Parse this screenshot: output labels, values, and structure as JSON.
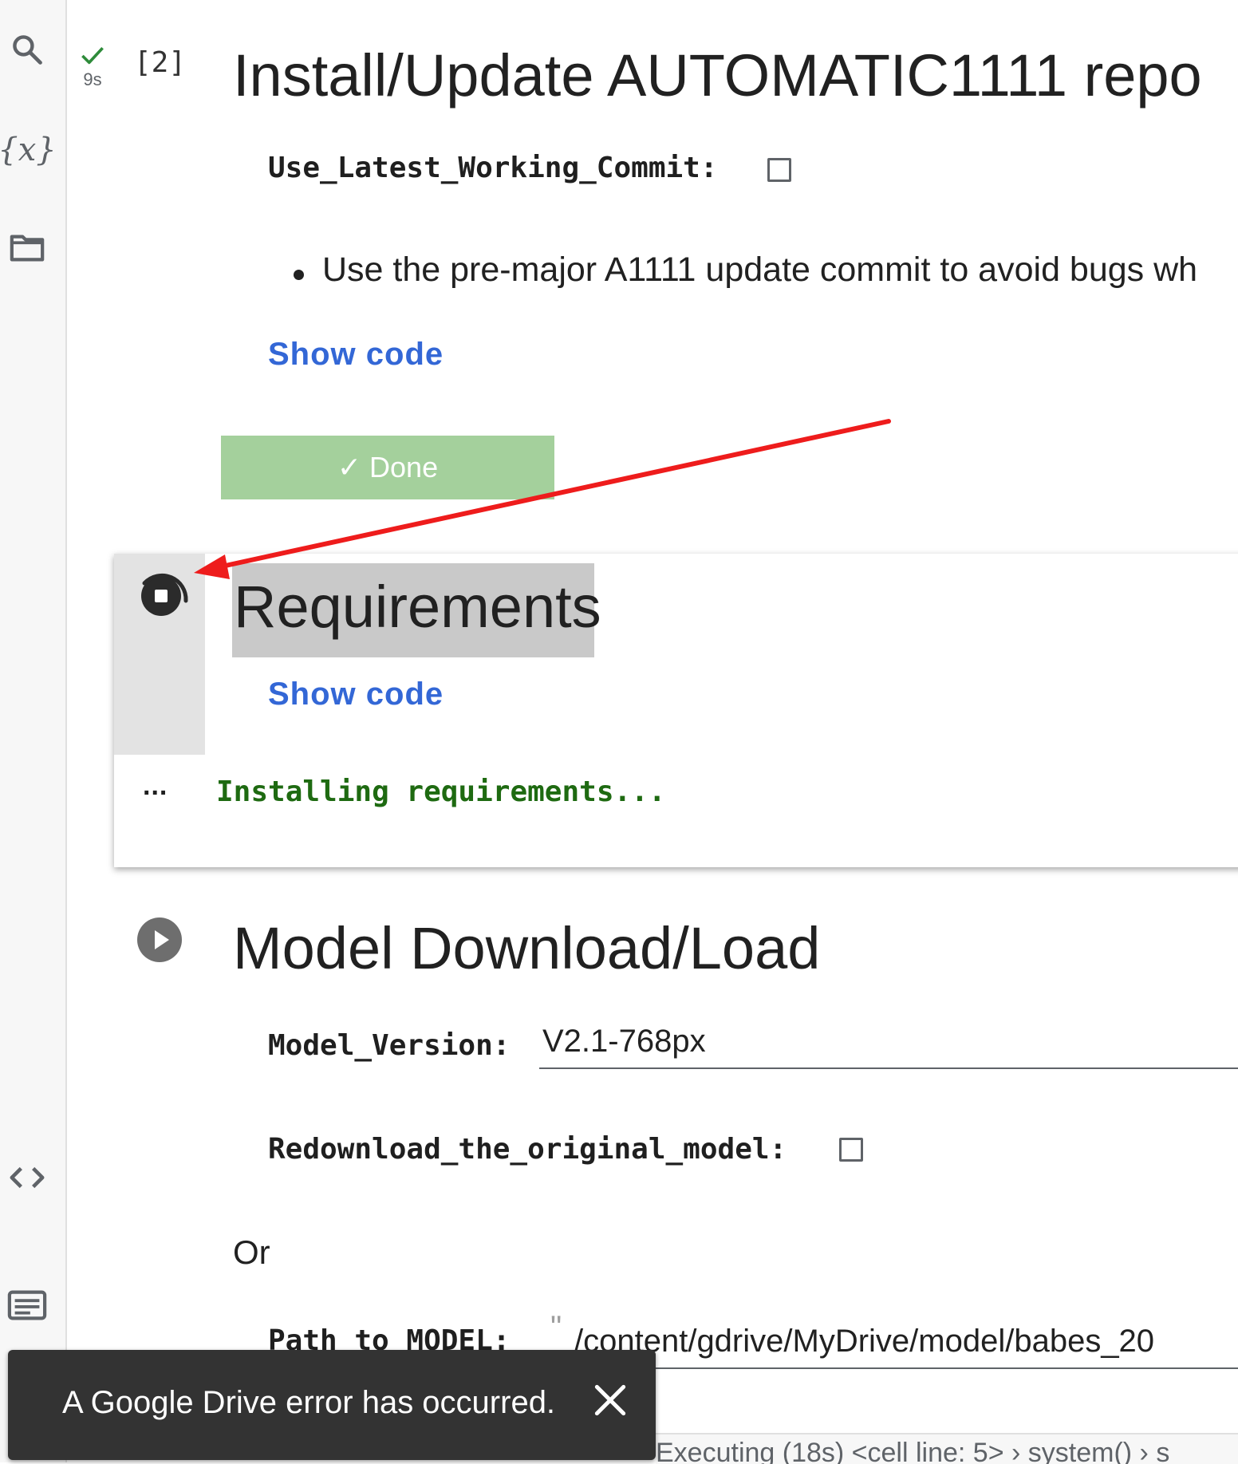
{
  "sidebar": {
    "icons": [
      "search-icon",
      "variables-icon",
      "folder-icon",
      "code-snippets-icon",
      "command-palette-icon"
    ],
    "variables_glyph": "{x}"
  },
  "cell1": {
    "execution_time": "9s",
    "execution_count": "[2]",
    "title": "Install/Update AUTOMATIC1111 repo",
    "param_label": "Use_Latest_Working_Commit:",
    "param_checked": false,
    "bullet_text": "Use the pre-major A1111 update commit to avoid bugs wh",
    "show_code": "Show code",
    "done_label": "✓ Done",
    "done_color": "#a4d09c"
  },
  "cell2": {
    "title": "Requirements",
    "show_code": "Show code",
    "output_prompt": "...",
    "output_text": "Installing requirements...",
    "output_color": "#1e6a11"
  },
  "cell3": {
    "title": "Model Download/Load",
    "model_version_label": "Model_Version:",
    "model_version_value": "V2.1-768px",
    "redownload_label": "Redownload_the_original_model:",
    "redownload_checked": false,
    "or_text": "Or",
    "path_label": "Path_to_MODEL:",
    "path_quote": "\"",
    "path_value": "/content/gdrive/MyDrive/model/babes_20"
  },
  "toast": {
    "message": "A Google Drive error has occurred."
  },
  "status_bar": {
    "text": "Executing (18s)  <cell line: 5> › system() › s"
  },
  "colors": {
    "link": "#3367d6",
    "annotation_arrow": "#ee1c1c"
  }
}
